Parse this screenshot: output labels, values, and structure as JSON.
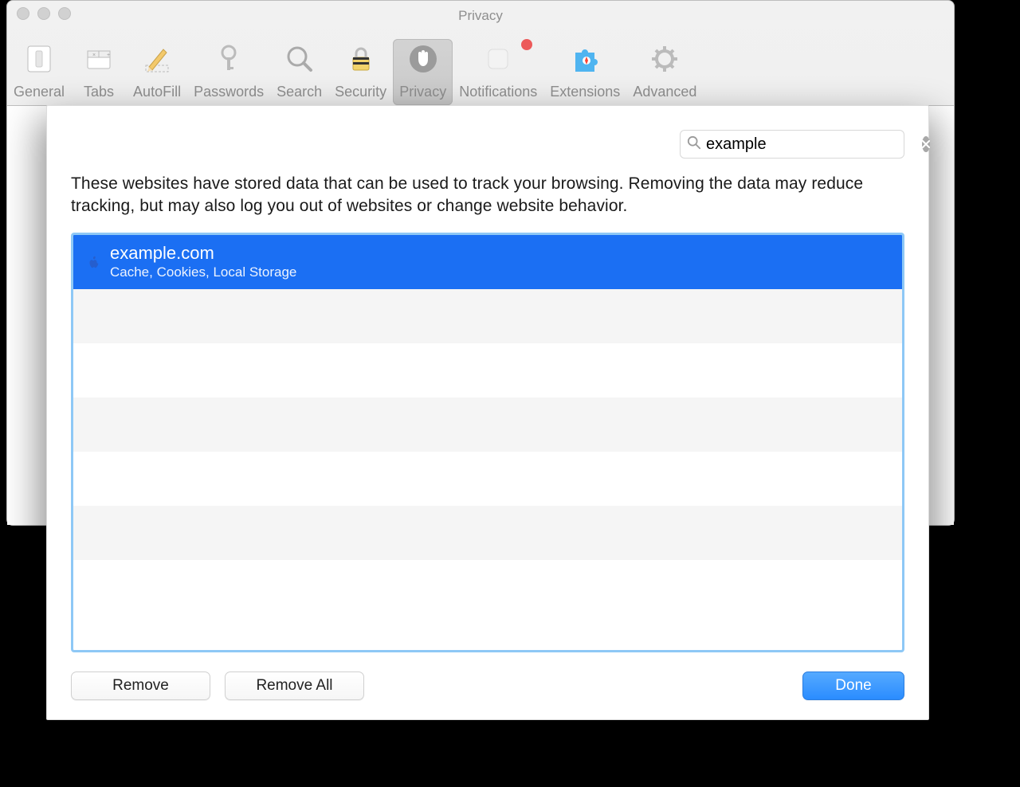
{
  "window": {
    "title": "Privacy"
  },
  "toolbar": {
    "items": [
      {
        "label": "General"
      },
      {
        "label": "Tabs"
      },
      {
        "label": "AutoFill"
      },
      {
        "label": "Passwords"
      },
      {
        "label": "Search"
      },
      {
        "label": "Security"
      },
      {
        "label": "Privacy"
      },
      {
        "label": "Notifications"
      },
      {
        "label": "Extensions"
      },
      {
        "label": "Advanced"
      }
    ]
  },
  "sheet": {
    "search_value": "example",
    "description": "These websites have stored data that can be used to track your browsing. Removing the data may reduce tracking, but may also log you out of websites or change website behavior.",
    "list": {
      "items": [
        {
          "domain": "example.com",
          "meta": "Cache, Cookies, Local Storage",
          "selected": true
        }
      ],
      "empty_row_count": 6
    },
    "buttons": {
      "remove": "Remove",
      "remove_all": "Remove All",
      "done": "Done"
    }
  }
}
